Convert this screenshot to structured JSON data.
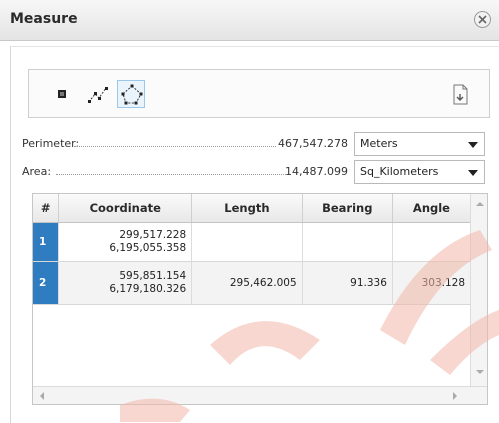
{
  "window": {
    "title": "Measure"
  },
  "toolbar": {
    "tools": [
      {
        "icon": "point-tool-icon"
      },
      {
        "icon": "line-tool-icon"
      },
      {
        "icon": "polygon-tool-icon"
      }
    ],
    "export_icon": "export-icon"
  },
  "perimeter": {
    "label": "Perimeter:",
    "value": "467,547.278",
    "unit": "Meters"
  },
  "area": {
    "label": "Area:",
    "value": "14,487.099",
    "unit": "Sq_Kilometers"
  },
  "table": {
    "columns": [
      "#",
      "Coordinate",
      "Length",
      "Bearing",
      "Angle"
    ],
    "rows": [
      {
        "num": "1",
        "coord_x": "299,517.228",
        "coord_y": "6,195,055.358",
        "length": "",
        "bearing": "",
        "angle": ""
      },
      {
        "num": "2",
        "coord_x": "595,851.154",
        "coord_y": "6,179,180.326",
        "length": "295,462.005",
        "bearing": "91.336",
        "angle": "303.128"
      }
    ]
  },
  "colors": {
    "selected_row_number": "#2f7cc0",
    "watermark": "#f1c1b6"
  }
}
